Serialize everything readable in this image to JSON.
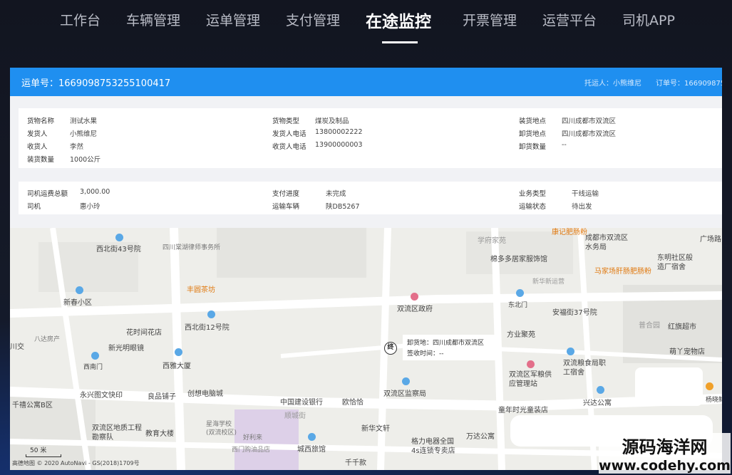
{
  "nav": {
    "items": [
      "工作台",
      "车辆管理",
      "运单管理",
      "支付管理",
      "在途监控",
      "开票管理",
      "运营平台",
      "司机APP"
    ],
    "active_index": 4
  },
  "header": {
    "waybill": "运单号：1669098753255100417",
    "shipper": "托运人：小熊维尼",
    "order": "订单号：166909875"
  },
  "cargo": {
    "name_label": "货物名称",
    "name_value": "测试水果",
    "type_label": "货物类型",
    "type_value": "煤炭及制品",
    "load_label": "装货地点",
    "load_value": "四川成都市双流区",
    "sender_label": "发货人",
    "sender_value": "小熊维尼",
    "sender_phone_label": "发货人电话",
    "sender_phone_value": "13800002222",
    "unload_label": "卸货地点",
    "unload_value": "四川成都市双流区",
    "receiver_label": "收货人",
    "receiver_value": "李然",
    "receiver_phone_label": "收货人电话",
    "receiver_phone_value": "13900000003",
    "unload_qty_label": "卸货数量",
    "unload_qty_value": "--",
    "load_qty_label": "装货数量",
    "load_qty_value": "1000公斤"
  },
  "payment": {
    "fee_label": "司机运费总额",
    "fee_value": "3,000.00",
    "progress_label": "支付进度",
    "progress_value": "未完成",
    "biz_label": "业务类型",
    "biz_value": "干线运输",
    "driver_label": "司机",
    "driver_value": "惠小玲",
    "vehicle_label": "运输车辆",
    "vehicle_value": "陕DB5267",
    "status_label": "运输状态",
    "status_value": "待出发"
  },
  "map": {
    "pois": [
      "西北街43号院",
      "四川棠湖律师事务所",
      "新春小区",
      "丰圆茶坊",
      "花时间花店",
      "西北街12号院",
      "新光明眼镜",
      "西南门",
      "西雅大厦",
      "永兴图文快印",
      "良品铺子",
      "创想电脑城",
      "千禧公寓B区",
      "双流区地质工程勘察队",
      "教育大楼",
      "星海学校(双流校区)",
      "好利来",
      "西门购油品店",
      "中国建设银行",
      "欧恰恰",
      "双流区监察局",
      "新华文轩",
      "城西旅馆",
      "千千款",
      "双流区政府",
      "学府家苑",
      "棉多多居家服饰馆",
      "新华新运营",
      "东北门",
      "方业聚苑",
      "安福街37号院",
      "双流区军粮供应管理站",
      "双流粮食局职工宿舍",
      "兴达公寓",
      "童年时光童装店",
      "万达公寓",
      "格力电器全国4s连锁专卖店",
      "成都市双流区水务局",
      "康记肥肠粉",
      "广场路",
      "东明社区般造厂宿舍",
      "马家场肝肠肥肠粉",
      "红旗超市",
      "萌丫宠物店",
      "杨晓鲜",
      "八达房产",
      "川交",
      "西北街",
      "双流区政府",
      "东明社区",
      "顺城街",
      "普合园"
    ],
    "popup_unload": "卸货地：四川成都市双流区",
    "popup_receive": "签收时间：--",
    "pin_label": "终",
    "scale": "50 米",
    "copyright": "高德地图 © 2020 AutoNavi - GS(2018)1709号"
  },
  "watermark": {
    "title": "源码海洋网",
    "url": "www.codehy.com"
  }
}
